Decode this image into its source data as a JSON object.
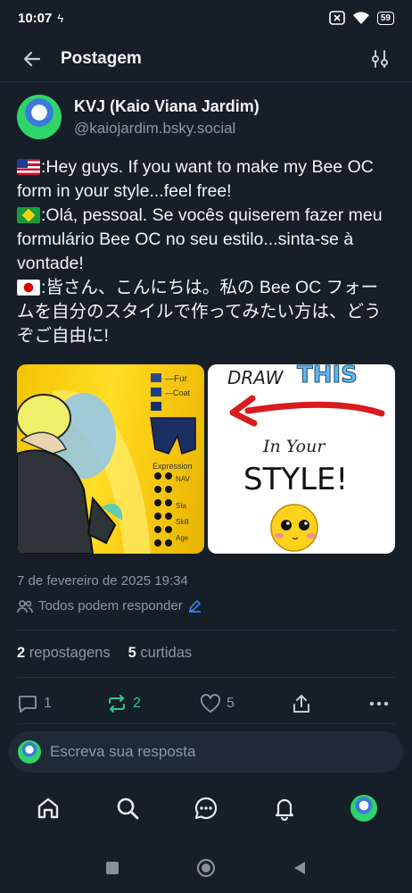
{
  "status": {
    "time": "10:07",
    "battery": "59"
  },
  "header": {
    "title": "Postagem"
  },
  "post": {
    "author_name": "KVJ (Kaio Viana Jardim)",
    "author_handle": "@kaiojardim.bsky.social",
    "text_en": ":Hey guys. If you want to make my Bee OC form in your style...feel free!",
    "text_pt": ":Olá, pessoal. Se vocês quiserem fazer meu formulário Bee OC no seu estilo...sinta-se à vontade!",
    "text_jp": ":皆さん、こんにちは。私の Bee OC フォームを自分のスタイルで作ってみたい方は、どうぞご自由に!",
    "image_left": {
      "label1": "—Fur",
      "label2": "—Coat",
      "label3": "Expression",
      "label4": "NAV",
      "label5": "Sta",
      "label6": "Skill",
      "label7": "Age"
    },
    "image_right": {
      "line1": "DRAW",
      "line2": "THIS",
      "line3": "In Your",
      "line4": "STYLE!"
    },
    "timestamp": "7 de fevereiro de 2025 19:34",
    "reply_setting": "Todos podem responder"
  },
  "stats": {
    "reposts_count": "2",
    "reposts_label": "repostagens",
    "likes_count": "5",
    "likes_label": "curtidas"
  },
  "actions": {
    "reply_count": "1",
    "repost_count": "2",
    "like_count": "5"
  },
  "compose": {
    "placeholder": "Escreva sua resposta"
  },
  "colors": {
    "background": "#161e27",
    "repost_active": "#32c884",
    "muted": "#8a98a8",
    "link": "#3f8cff"
  }
}
